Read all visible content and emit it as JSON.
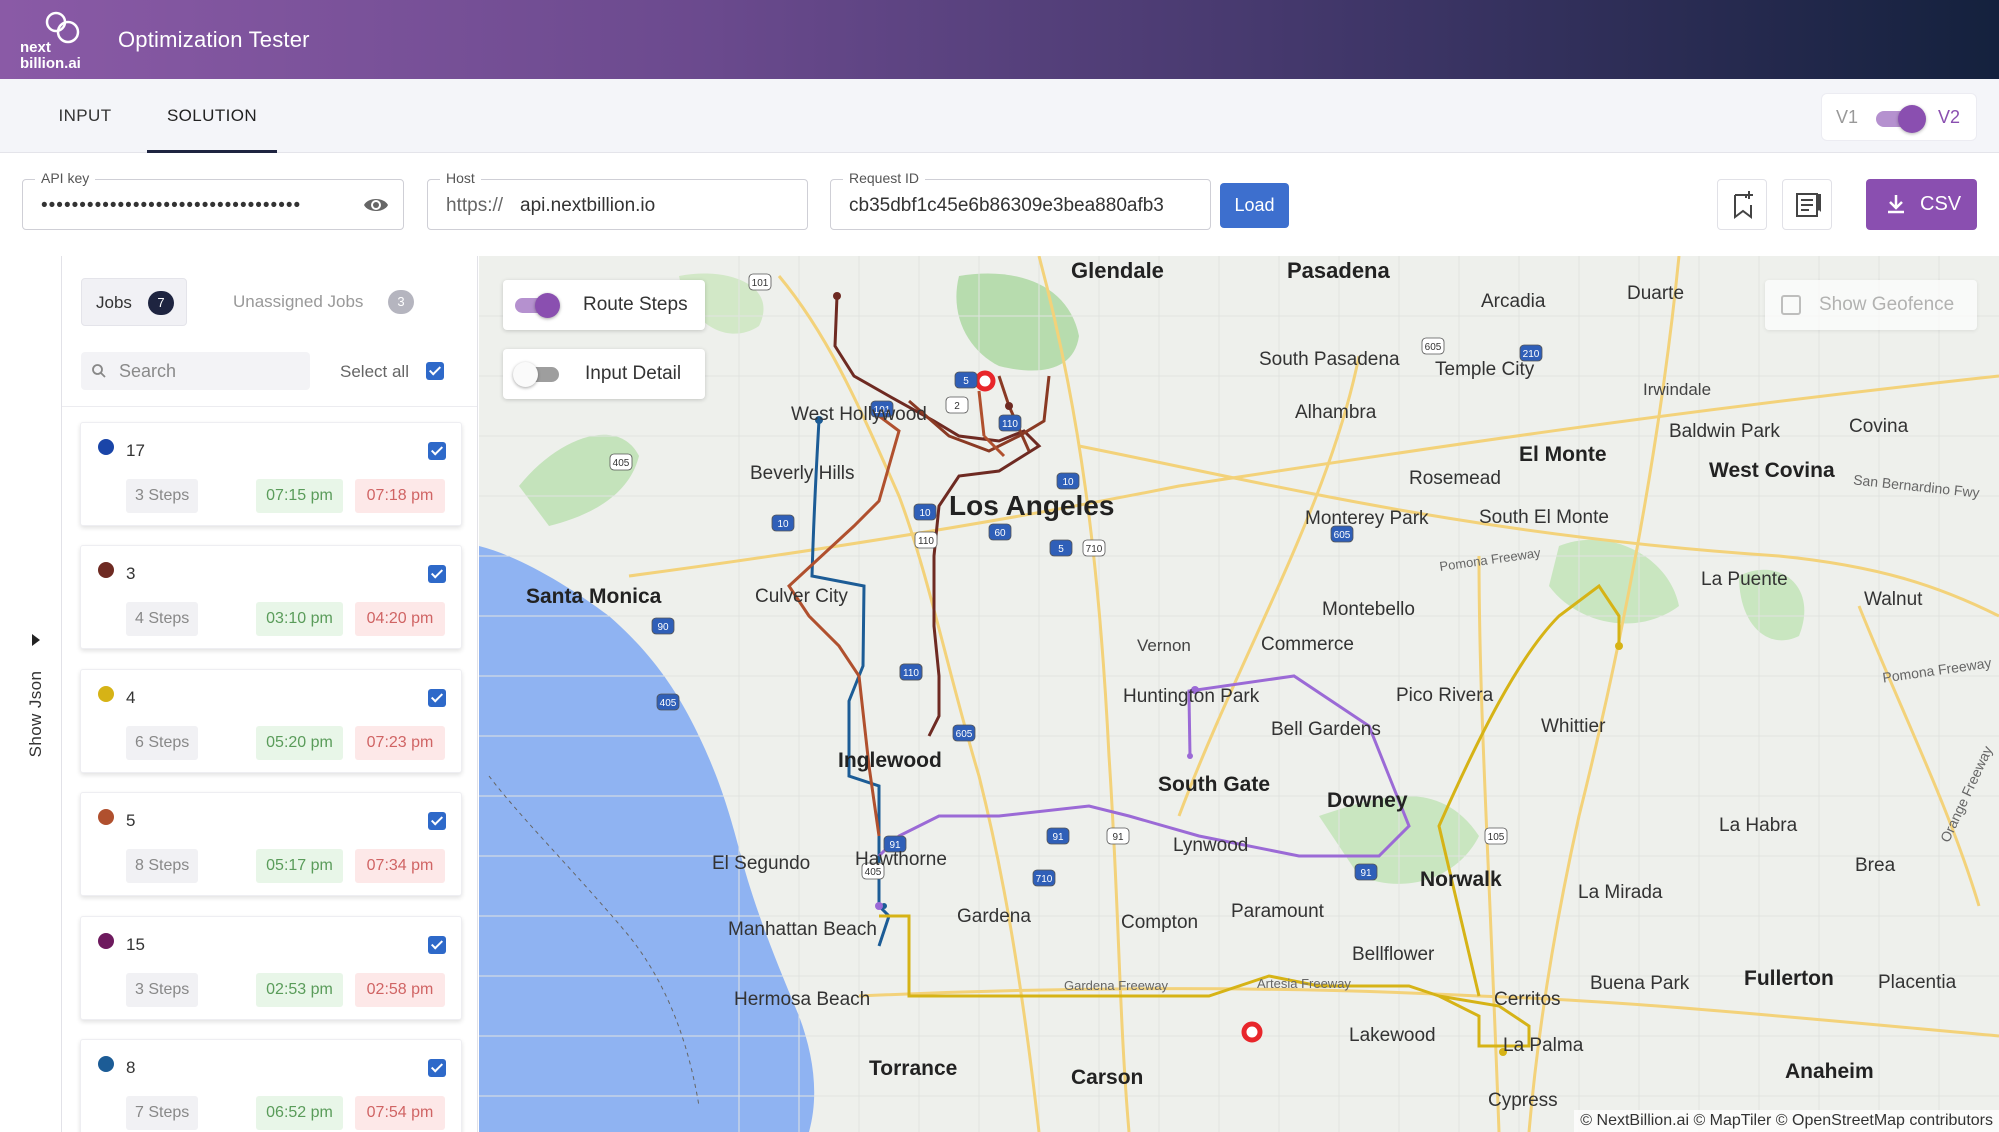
{
  "header": {
    "logo_line1": "next",
    "logo_line2": "billion.ai",
    "title": "Optimization Tester"
  },
  "tabs": {
    "input": "INPUT",
    "solution": "SOLUTION",
    "active": "SOLUTION"
  },
  "version_switch": {
    "v1": "V1",
    "v2": "V2",
    "selected": "V2"
  },
  "inputs": {
    "api_key": {
      "label": "API key",
      "value": "••••••••••••••••••••••••••••••••••"
    },
    "host": {
      "label": "Host",
      "prefix": "https://",
      "value": "api.nextbillion.io"
    },
    "request_id": {
      "label": "Request ID",
      "value": "cb35dbf1c45e6b86309e3bea880afb3"
    }
  },
  "buttons": {
    "load": "Load",
    "csv": "CSV"
  },
  "show_json": "Show Json",
  "jobs_panel": {
    "tab_jobs": "Jobs",
    "jobs_count": "7",
    "tab_unassigned": "Unassigned Jobs",
    "unassigned_count": "3",
    "search_placeholder": "Search",
    "select_all": "Select all",
    "cards": [
      {
        "id": "17",
        "color": "#1a45a8",
        "steps": "3 Steps",
        "start": "07:15 pm",
        "end": "07:18 pm"
      },
      {
        "id": "3",
        "color": "#6e2a22",
        "steps": "4 Steps",
        "start": "03:10 pm",
        "end": "04:20 pm"
      },
      {
        "id": "4",
        "color": "#d6b316",
        "steps": "6 Steps",
        "start": "05:20 pm",
        "end": "07:23 pm"
      },
      {
        "id": "5",
        "color": "#b0502e",
        "steps": "8 Steps",
        "start": "05:17 pm",
        "end": "07:34 pm"
      },
      {
        "id": "15",
        "color": "#6e1a5e",
        "steps": "3 Steps",
        "start": "02:53 pm",
        "end": "02:58 pm"
      },
      {
        "id": "8",
        "color": "#1c5c96",
        "steps": "7 Steps",
        "start": "06:52 pm",
        "end": "07:54 pm"
      }
    ]
  },
  "map": {
    "route_steps": "Route Steps",
    "input_detail": "Input Detail",
    "show_geofence": "Show Geofence",
    "attribution": "© NextBillion.ai © MapTiler © OpenStreetMap contributors",
    "places": {
      "glendale": "Glendale",
      "pasadena": "Pasadena",
      "arcadia": "Arcadia",
      "duarte": "Duarte",
      "south_pasadena": "South Pasadena",
      "temple_city": "Temple City",
      "irwindale": "Irwindale",
      "west_hollywood": "West Hollywood",
      "alhambra": "Alhambra",
      "baldwin_park": "Baldwin Park",
      "covina": "Covina",
      "beverly_hills": "Beverly Hills",
      "el_monte": "El Monte",
      "rosemead": "Rosemead",
      "west_covina": "West Covina",
      "los_angeles": "Los Angeles",
      "monterey_park": "Monterey Park",
      "south_el_monte": "South El Monte",
      "santa_monica": "Santa Monica",
      "culver_city": "Culver City",
      "la_puente": "La Puente",
      "walnut": "Walnut",
      "montebello": "Montebello",
      "vernon": "Vernon",
      "commerce": "Commerce",
      "huntington_park": "Huntington Park",
      "pico_rivera": "Pico Rivera",
      "bell_gardens": "Bell Gardens",
      "whittier": "Whittier",
      "inglewood": "Inglewood",
      "south_gate": "South Gate",
      "downey": "Downey",
      "la_habra": "La Habra",
      "brea": "Brea",
      "el_segundo": "El Segundo",
      "hawthorne": "Hawthorne",
      "lynwood": "Lynwood",
      "norwalk": "Norwalk",
      "la_mirada": "La Mirada",
      "gardena": "Gardena",
      "compton": "Compton",
      "paramount": "Paramount",
      "manhattan_beach": "Manhattan Beach",
      "bellflower": "Bellflower",
      "buena_park": "Buena Park",
      "fullerton": "Fullerton",
      "placentia": "Placentia",
      "hermosa_beach": "Hermosa Beach",
      "cerritos": "Cerritos",
      "lakewood": "Lakewood",
      "la_palma": "La Palma",
      "torrance": "Torrance",
      "carson": "Carson",
      "anaheim": "Anaheim",
      "cypress": "Cypress",
      "pomona_fwy": "Pomona Freeway",
      "gardena_fwy": "Gardena Freeway",
      "artesia_fwy": "Artesia Freeway",
      "sb_fwy": "San Bernardino Fwy",
      "pomona_fwy2": "Pomona Freeway",
      "orange_fwy": "Orange Freeway"
    },
    "shields": [
      "101",
      "101",
      "5",
      "2",
      "110",
      "10",
      "405",
      "10",
      "10",
      "110",
      "60",
      "5",
      "710",
      "605",
      "210",
      "605",
      "90",
      "405",
      "110",
      "110",
      "605",
      "405",
      "91",
      "91",
      "91",
      "710",
      "91",
      "105"
    ]
  }
}
